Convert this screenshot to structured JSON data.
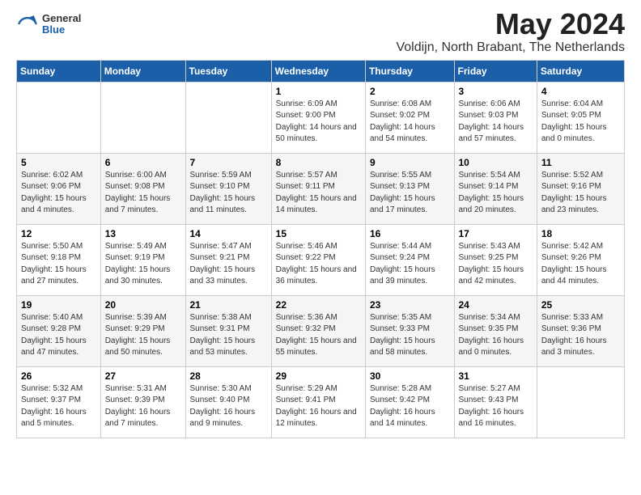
{
  "logo": {
    "general": "General",
    "blue": "Blue"
  },
  "title": "May 2024",
  "location": "Voldijn, North Brabant, The Netherlands",
  "weekdays": [
    "Sunday",
    "Monday",
    "Tuesday",
    "Wednesday",
    "Thursday",
    "Friday",
    "Saturday"
  ],
  "weeks": [
    {
      "days": [
        {
          "num": "",
          "sunrise": "",
          "sunset": "",
          "daylight": ""
        },
        {
          "num": "",
          "sunrise": "",
          "sunset": "",
          "daylight": ""
        },
        {
          "num": "",
          "sunrise": "",
          "sunset": "",
          "daylight": ""
        },
        {
          "num": "1",
          "sunrise": "Sunrise: 6:09 AM",
          "sunset": "Sunset: 9:00 PM",
          "daylight": "Daylight: 14 hours and 50 minutes."
        },
        {
          "num": "2",
          "sunrise": "Sunrise: 6:08 AM",
          "sunset": "Sunset: 9:02 PM",
          "daylight": "Daylight: 14 hours and 54 minutes."
        },
        {
          "num": "3",
          "sunrise": "Sunrise: 6:06 AM",
          "sunset": "Sunset: 9:03 PM",
          "daylight": "Daylight: 14 hours and 57 minutes."
        },
        {
          "num": "4",
          "sunrise": "Sunrise: 6:04 AM",
          "sunset": "Sunset: 9:05 PM",
          "daylight": "Daylight: 15 hours and 0 minutes."
        }
      ]
    },
    {
      "days": [
        {
          "num": "5",
          "sunrise": "Sunrise: 6:02 AM",
          "sunset": "Sunset: 9:06 PM",
          "daylight": "Daylight: 15 hours and 4 minutes."
        },
        {
          "num": "6",
          "sunrise": "Sunrise: 6:00 AM",
          "sunset": "Sunset: 9:08 PM",
          "daylight": "Daylight: 15 hours and 7 minutes."
        },
        {
          "num": "7",
          "sunrise": "Sunrise: 5:59 AM",
          "sunset": "Sunset: 9:10 PM",
          "daylight": "Daylight: 15 hours and 11 minutes."
        },
        {
          "num": "8",
          "sunrise": "Sunrise: 5:57 AM",
          "sunset": "Sunset: 9:11 PM",
          "daylight": "Daylight: 15 hours and 14 minutes."
        },
        {
          "num": "9",
          "sunrise": "Sunrise: 5:55 AM",
          "sunset": "Sunset: 9:13 PM",
          "daylight": "Daylight: 15 hours and 17 minutes."
        },
        {
          "num": "10",
          "sunrise": "Sunrise: 5:54 AM",
          "sunset": "Sunset: 9:14 PM",
          "daylight": "Daylight: 15 hours and 20 minutes."
        },
        {
          "num": "11",
          "sunrise": "Sunrise: 5:52 AM",
          "sunset": "Sunset: 9:16 PM",
          "daylight": "Daylight: 15 hours and 23 minutes."
        }
      ]
    },
    {
      "days": [
        {
          "num": "12",
          "sunrise": "Sunrise: 5:50 AM",
          "sunset": "Sunset: 9:18 PM",
          "daylight": "Daylight: 15 hours and 27 minutes."
        },
        {
          "num": "13",
          "sunrise": "Sunrise: 5:49 AM",
          "sunset": "Sunset: 9:19 PM",
          "daylight": "Daylight: 15 hours and 30 minutes."
        },
        {
          "num": "14",
          "sunrise": "Sunrise: 5:47 AM",
          "sunset": "Sunset: 9:21 PM",
          "daylight": "Daylight: 15 hours and 33 minutes."
        },
        {
          "num": "15",
          "sunrise": "Sunrise: 5:46 AM",
          "sunset": "Sunset: 9:22 PM",
          "daylight": "Daylight: 15 hours and 36 minutes."
        },
        {
          "num": "16",
          "sunrise": "Sunrise: 5:44 AM",
          "sunset": "Sunset: 9:24 PM",
          "daylight": "Daylight: 15 hours and 39 minutes."
        },
        {
          "num": "17",
          "sunrise": "Sunrise: 5:43 AM",
          "sunset": "Sunset: 9:25 PM",
          "daylight": "Daylight: 15 hours and 42 minutes."
        },
        {
          "num": "18",
          "sunrise": "Sunrise: 5:42 AM",
          "sunset": "Sunset: 9:26 PM",
          "daylight": "Daylight: 15 hours and 44 minutes."
        }
      ]
    },
    {
      "days": [
        {
          "num": "19",
          "sunrise": "Sunrise: 5:40 AM",
          "sunset": "Sunset: 9:28 PM",
          "daylight": "Daylight: 15 hours and 47 minutes."
        },
        {
          "num": "20",
          "sunrise": "Sunrise: 5:39 AM",
          "sunset": "Sunset: 9:29 PM",
          "daylight": "Daylight: 15 hours and 50 minutes."
        },
        {
          "num": "21",
          "sunrise": "Sunrise: 5:38 AM",
          "sunset": "Sunset: 9:31 PM",
          "daylight": "Daylight: 15 hours and 53 minutes."
        },
        {
          "num": "22",
          "sunrise": "Sunrise: 5:36 AM",
          "sunset": "Sunset: 9:32 PM",
          "daylight": "Daylight: 15 hours and 55 minutes."
        },
        {
          "num": "23",
          "sunrise": "Sunrise: 5:35 AM",
          "sunset": "Sunset: 9:33 PM",
          "daylight": "Daylight: 15 hours and 58 minutes."
        },
        {
          "num": "24",
          "sunrise": "Sunrise: 5:34 AM",
          "sunset": "Sunset: 9:35 PM",
          "daylight": "Daylight: 16 hours and 0 minutes."
        },
        {
          "num": "25",
          "sunrise": "Sunrise: 5:33 AM",
          "sunset": "Sunset: 9:36 PM",
          "daylight": "Daylight: 16 hours and 3 minutes."
        }
      ]
    },
    {
      "days": [
        {
          "num": "26",
          "sunrise": "Sunrise: 5:32 AM",
          "sunset": "Sunset: 9:37 PM",
          "daylight": "Daylight: 16 hours and 5 minutes."
        },
        {
          "num": "27",
          "sunrise": "Sunrise: 5:31 AM",
          "sunset": "Sunset: 9:39 PM",
          "daylight": "Daylight: 16 hours and 7 minutes."
        },
        {
          "num": "28",
          "sunrise": "Sunrise: 5:30 AM",
          "sunset": "Sunset: 9:40 PM",
          "daylight": "Daylight: 16 hours and 9 minutes."
        },
        {
          "num": "29",
          "sunrise": "Sunrise: 5:29 AM",
          "sunset": "Sunset: 9:41 PM",
          "daylight": "Daylight: 16 hours and 12 minutes."
        },
        {
          "num": "30",
          "sunrise": "Sunrise: 5:28 AM",
          "sunset": "Sunset: 9:42 PM",
          "daylight": "Daylight: 16 hours and 14 minutes."
        },
        {
          "num": "31",
          "sunrise": "Sunrise: 5:27 AM",
          "sunset": "Sunset: 9:43 PM",
          "daylight": "Daylight: 16 hours and 16 minutes."
        },
        {
          "num": "",
          "sunrise": "",
          "sunset": "",
          "daylight": ""
        }
      ]
    }
  ]
}
